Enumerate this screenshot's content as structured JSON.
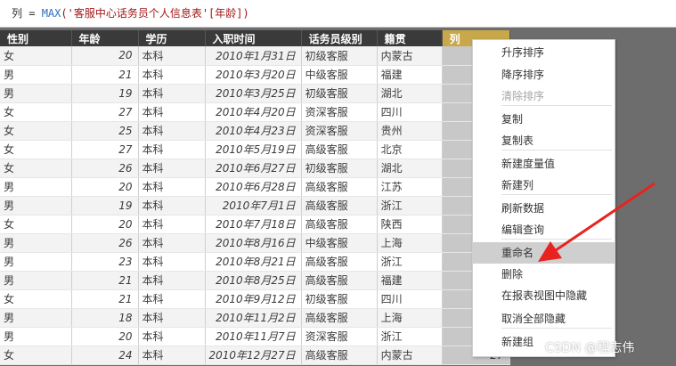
{
  "formula_bar": {
    "prefix": "列 = ",
    "function": "MAX",
    "argument": "('客服中心话务员个人信息表'[年龄])"
  },
  "table": {
    "columns": [
      "性别",
      "年龄",
      "学历",
      "入职时间",
      "话务员级别",
      "籍贯",
      "列"
    ],
    "rows": [
      [
        "女",
        "20",
        "本科",
        "2010年1月31日",
        "初级客服",
        "内蒙古",
        ""
      ],
      [
        "男",
        "21",
        "本科",
        "2010年3月20日",
        "中级客服",
        "福建",
        ""
      ],
      [
        "男",
        "19",
        "本科",
        "2010年3月25日",
        "初级客服",
        "湖北",
        ""
      ],
      [
        "女",
        "27",
        "本科",
        "2010年4月20日",
        "资深客服",
        "四川",
        ""
      ],
      [
        "女",
        "25",
        "本科",
        "2010年4月23日",
        "资深客服",
        "贵州",
        ""
      ],
      [
        "女",
        "27",
        "本科",
        "2010年5月19日",
        "高级客服",
        "北京",
        ""
      ],
      [
        "女",
        "26",
        "本科",
        "2010年6月27日",
        "初级客服",
        "湖北",
        ""
      ],
      [
        "男",
        "20",
        "本科",
        "2010年6月28日",
        "高级客服",
        "江苏",
        ""
      ],
      [
        "男",
        "19",
        "本科",
        "2010年7月1日",
        "高级客服",
        "浙江",
        ""
      ],
      [
        "女",
        "20",
        "本科",
        "2010年7月18日",
        "高级客服",
        "陕西",
        ""
      ],
      [
        "男",
        "26",
        "本科",
        "2010年8月16日",
        "中级客服",
        "上海",
        ""
      ],
      [
        "男",
        "23",
        "本科",
        "2010年8月21日",
        "高级客服",
        "浙江",
        ""
      ],
      [
        "男",
        "21",
        "本科",
        "2010年8月25日",
        "高级客服",
        "福建",
        ""
      ],
      [
        "女",
        "21",
        "本科",
        "2010年9月12日",
        "初级客服",
        "四川",
        ""
      ],
      [
        "男",
        "18",
        "本科",
        "2010年11月2日",
        "高级客服",
        "上海",
        ""
      ],
      [
        "男",
        "20",
        "本科",
        "2010年11月7日",
        "资深客服",
        "浙江",
        ""
      ],
      [
        "女",
        "24",
        "本科",
        "2010年12月27日",
        "高级客服",
        "内蒙古",
        "27"
      ]
    ]
  },
  "context_menu": {
    "items": [
      {
        "label": "升序排序",
        "disabled": false
      },
      {
        "label": "降序排序",
        "disabled": false
      },
      {
        "label": "清除排序",
        "disabled": true
      },
      {
        "label": "复制",
        "disabled": false
      },
      {
        "label": "复制表",
        "disabled": false
      },
      {
        "label": "新建度量值",
        "disabled": false
      },
      {
        "label": "新建列",
        "disabled": false
      },
      {
        "label": "刷新数据",
        "disabled": false
      },
      {
        "label": "编辑查询",
        "disabled": false
      },
      {
        "label": "重命名",
        "disabled": false,
        "highlighted": true
      },
      {
        "label": "删除",
        "disabled": false
      },
      {
        "label": "在报表视图中隐藏",
        "disabled": false
      },
      {
        "label": "取消全部隐藏",
        "disabled": false
      },
      {
        "label": "新建组",
        "disabled": false
      }
    ]
  },
  "annotation": {
    "arrow_color": "#e8231f"
  },
  "watermark": "CSDN @程志伟",
  "colors": {
    "header_bg": "#3a3a3a",
    "selected_column_header": "#c8a84a",
    "selected_column_cells": "#c8c8c8",
    "menu_highlight": "#cfcfcf"
  }
}
